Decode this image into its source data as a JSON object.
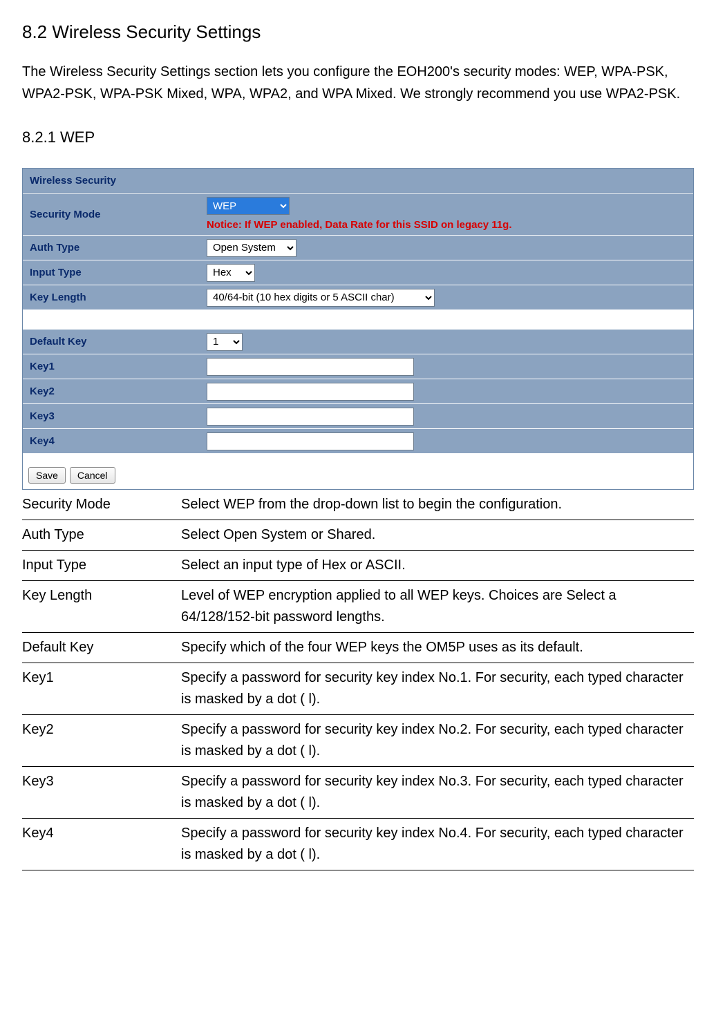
{
  "section": {
    "title": "8.2 Wireless Security Settings",
    "intro": "The Wireless Security Settings section lets you configure the EOH200's security modes: WEP, WPA-PSK, WPA2-PSK, WPA-PSK Mixed, WPA, WPA2, and WPA Mixed. We strongly recommend you use WPA2-PSK."
  },
  "subsection": {
    "title": "8.2.1 WEP"
  },
  "panel": {
    "header": "Wireless Security",
    "security_mode": {
      "label": "Security Mode",
      "value": "WEP"
    },
    "notice": "Notice: If WEP enabled, Data Rate for this SSID on legacy 11g.",
    "auth_type": {
      "label": "Auth Type",
      "value": "Open System"
    },
    "input_type": {
      "label": "Input Type",
      "value": "Hex"
    },
    "key_length": {
      "label": "Key Length",
      "value": "40/64-bit (10 hex digits or 5 ASCII char)"
    },
    "default_key": {
      "label": "Default Key",
      "value": "1"
    },
    "key1": {
      "label": "Key1",
      "value": ""
    },
    "key2": {
      "label": "Key2",
      "value": ""
    },
    "key3": {
      "label": "Key3",
      "value": ""
    },
    "key4": {
      "label": "Key4",
      "value": ""
    },
    "save": "Save",
    "cancel": "Cancel"
  },
  "desc": {
    "rows": [
      {
        "term": "Security Mode",
        "def": "Select WEP from the drop-down  list to begin the configuration."
      },
      {
        "term": "Auth Type",
        "def": "Select Open System or Shared."
      },
      {
        "term": "Input Type",
        "def": "Select an input type of Hex or ASCII."
      },
      {
        "term": "Key Length",
        "def": "Level of WEP encryption applied to all WEP keys. Choices are Select a 64/128/152-bit password lengths."
      },
      {
        "term": "Default Key",
        "def": "Specify which of the four WEP keys the OM5P  uses as its default."
      },
      {
        "term": "Key1",
        "def": "Specify a password for security key index No.1. For security, each typed character is masked by a dot (   l)."
      },
      {
        "term": "Key2",
        "def": "Specify a password for security key index No.2. For security, each typed character is masked by a dot (   l)."
      },
      {
        "term": "Key3",
        "def": "Specify a password for security key index No.3. For security, each typed character is masked by a dot (   l)."
      },
      {
        "term": "Key4",
        "def": "Specify a password for security key index No.4. For security, each typed character is masked by a dot (   l)."
      }
    ]
  }
}
